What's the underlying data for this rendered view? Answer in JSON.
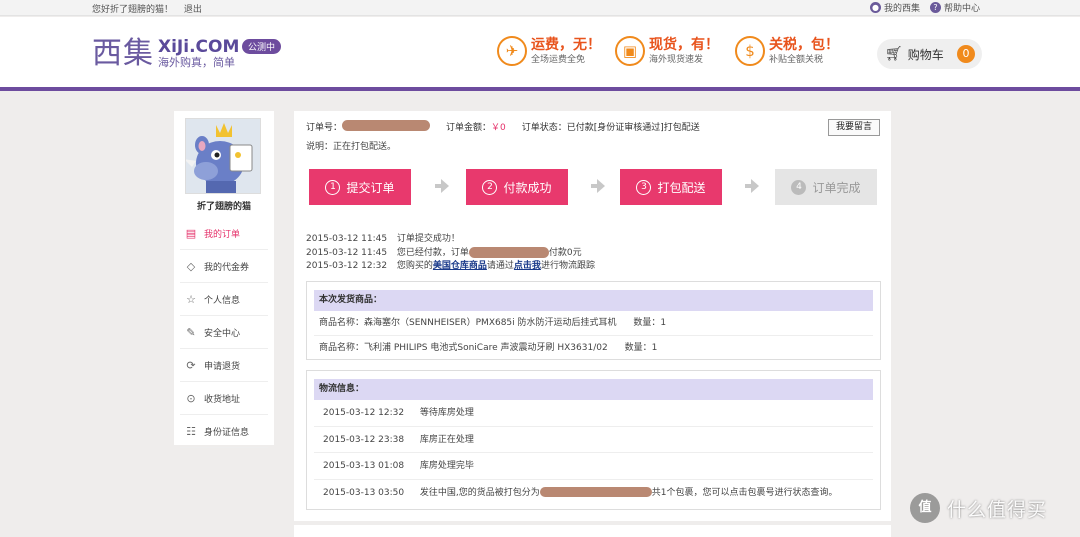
{
  "topbar": {
    "greeting": "您好折了翅膀的猫！",
    "logout": "退出",
    "my_xiji": "我的西集",
    "help": "帮助中心"
  },
  "header": {
    "logo_cn": "西集",
    "logo_en": "XiJi.COM",
    "logo_sub": "海外购真，简单",
    "beta_badge": "公测中",
    "promos": [
      {
        "icon": "airplane-icon",
        "title": "运费，无！",
        "sub": "全场运费全免"
      },
      {
        "icon": "gift-box-icon",
        "title": "现货，有！",
        "sub": "海外现货速发"
      },
      {
        "icon": "money-bag-icon",
        "title": "关税，包！",
        "sub": "补贴全额关税"
      }
    ],
    "cart_label": "购物车",
    "cart_count": "0"
  },
  "sidebar": {
    "username": "折了翅膀的猫",
    "items": [
      {
        "label": "我的订单",
        "icon": "document-icon",
        "active": true
      },
      {
        "label": "我的代金券",
        "icon": "tag-icon",
        "active": false
      },
      {
        "label": "个人信息",
        "icon": "star-icon",
        "active": false
      },
      {
        "label": "安全中心",
        "icon": "edit-icon",
        "active": false
      },
      {
        "label": "申请退货",
        "icon": "refresh-icon",
        "active": false
      },
      {
        "label": "收货地址",
        "icon": "location-pin-icon",
        "active": false
      },
      {
        "label": "身份证信息",
        "icon": "id-card-icon",
        "active": false
      }
    ]
  },
  "order": {
    "number_label": "订单号：",
    "amount_label": "订单金额：",
    "amount_value": "￥0",
    "status_label": "订单状态：",
    "status_value": "已付款[身份证审核通过]打包配送",
    "message_button": "我要留言",
    "note": "说明：正在打包配送。"
  },
  "steps": [
    {
      "num": "1",
      "label": "提交订单"
    },
    {
      "num": "2",
      "label": "付款成功"
    },
    {
      "num": "3",
      "label": "打包配送"
    },
    {
      "num": "4",
      "label": "订单完成"
    }
  ],
  "log": {
    "l1_time": "2015-03-12 11:45",
    "l1_text": "订单提交成功！",
    "l2_time": "2015-03-12 11:45",
    "l2_text_a": "您已经付款，订单",
    "l2_text_b": "付款0元",
    "l3_time": "2015-03-12 12:32",
    "l3_text_a": "您购买的",
    "l3_link1": "美国仓库商品",
    "l3_text_b": "请通过",
    "l3_link2": "点击我",
    "l3_text_c": "进行物流跟踪"
  },
  "shipment": {
    "title": "本次发货商品：",
    "items": [
      {
        "name": "商品名称：森海塞尔（SENNHEISER）PMX685i 防水防汗运动后挂式耳机",
        "qty": "数量：1"
      },
      {
        "name": "商品名称：飞利浦 PHILIPS 电池式SoniCare 声波震动牙刷 HX3631/02",
        "qty": "数量：1"
      }
    ]
  },
  "logistics": {
    "title": "物流信息：",
    "rows": [
      {
        "time": "2015-03-12 12:32",
        "text": "等待库房处理"
      },
      {
        "time": "2015-03-12 23:38",
        "text": "库房正在处理"
      },
      {
        "time": "2015-03-13 01:08",
        "text": "库房处理完毕"
      },
      {
        "time": "2015-03-13 03:50",
        "text_a": "发往中国,您的货品被打包分为",
        "text_b": "共1个包裹，您可以点击包裹号进行状态查询。"
      }
    ]
  },
  "watermark": {
    "badge": "值",
    "text": "什么值得买"
  }
}
